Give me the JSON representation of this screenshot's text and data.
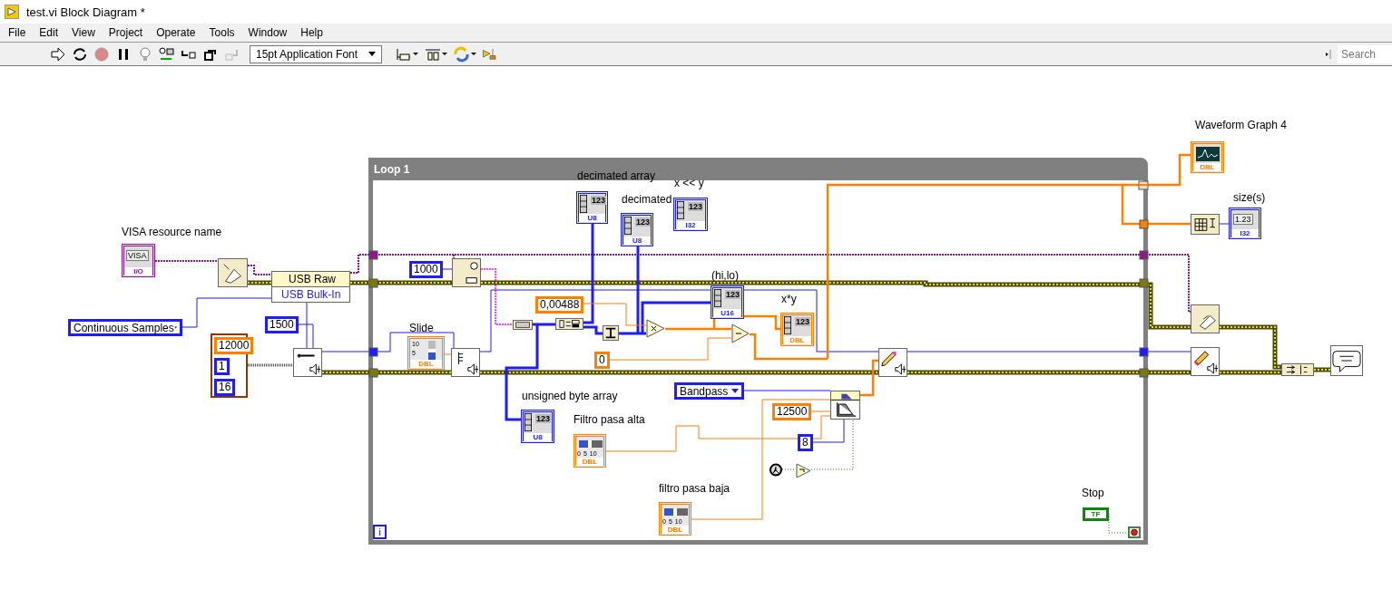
{
  "window": {
    "title": "test.vi Block Diagram *"
  },
  "menu": [
    "File",
    "Edit",
    "View",
    "Project",
    "Operate",
    "Tools",
    "Window",
    "Help"
  ],
  "toolbar": {
    "font": "15pt Application Font",
    "search": {
      "placeholder": "Search"
    }
  },
  "diagram": {
    "loop": {
      "label": "Loop 1",
      "iteration": "i"
    },
    "captions": [
      "VISA resource name",
      "Slide",
      "decimated array",
      "decimated",
      "x << y",
      "(hi,lo)",
      "x*y",
      "unsigned byte array",
      "Filtro pasa alta",
      "filtro pasa baja",
      "Waveform Graph 4",
      "size(s)",
      "Stop"
    ],
    "constants": [
      {
        "value": "1000",
        "color": "#1d1dff"
      },
      {
        "value": "1500",
        "color": "#1d1dff"
      },
      {
        "value": "0,00488",
        "color": "#ff7f00"
      },
      {
        "value": "0",
        "color": "#ff7f00"
      },
      {
        "value": "12500",
        "color": "#ff7f00"
      },
      {
        "value": "8",
        "color": "#1d1dff"
      }
    ],
    "cluster_constant": [
      {
        "value": "12000",
        "color": "#ff7f00"
      },
      {
        "value": "1",
        "color": "#1d1dff"
      },
      {
        "value": "16",
        "color": "#1d1dff"
      }
    ],
    "rings": [
      {
        "value": "Continuous Samples"
      },
      {
        "value": "Bandpass"
      }
    ],
    "property_node": {
      "class": "USB Raw",
      "property": "USB Bulk-In"
    },
    "terminals": [
      {
        "kind": "visa",
        "display": "VISA",
        "type": "I/O"
      },
      {
        "kind": "vslide",
        "ticks": [
          "10",
          "5"
        ],
        "type": "DBL"
      },
      {
        "kind": "array",
        "display": "123",
        "type": "U8"
      },
      {
        "kind": "array",
        "display": "123",
        "type": "U8"
      },
      {
        "kind": "array",
        "display": "123",
        "type": "I32"
      },
      {
        "kind": "array",
        "display": "123",
        "type": "U16"
      },
      {
        "kind": "array",
        "display": "123",
        "type": "DBL"
      },
      {
        "kind": "array",
        "display": "123",
        "type": "U8"
      },
      {
        "kind": "hslide",
        "ticks": [
          "0",
          "5",
          "10"
        ],
        "type": "DBL"
      },
      {
        "kind": "hslide",
        "ticks": [
          "0",
          "5",
          "10"
        ],
        "type": "DBL"
      },
      {
        "kind": "graph",
        "type": "DBL"
      },
      {
        "kind": "numeric",
        "display": "1.23",
        "type": "I32"
      },
      {
        "kind": "boolean",
        "display": "TF",
        "color": "#0a8a0a"
      }
    ]
  }
}
